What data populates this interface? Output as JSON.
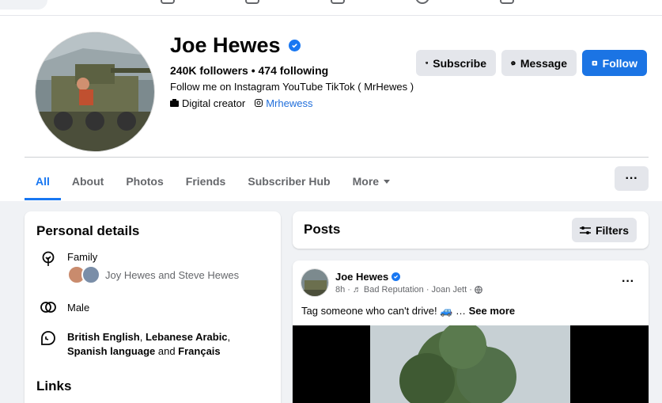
{
  "profile": {
    "name": "Joe Hewes",
    "stats": "240K followers • 474 following",
    "bio": "Follow me on Instagram YouTube TikTok ( MrHewes )",
    "category": "Digital creator",
    "instagram": "Mrhewess"
  },
  "actions": {
    "subscribe": "Subscribe",
    "message": "Message",
    "follow": "Follow"
  },
  "tabs": [
    {
      "label": "All"
    },
    {
      "label": "About"
    },
    {
      "label": "Photos"
    },
    {
      "label": "Friends"
    },
    {
      "label": "Subscriber Hub"
    },
    {
      "label": "More"
    }
  ],
  "more_menu": "···",
  "personal": {
    "title": "Personal details",
    "family_label": "Family",
    "family_names": "Joy Hewes and Steve Hewes",
    "gender": "Male",
    "languages": {
      "lang1": "British English",
      "sep1": ", ",
      "lang2": "Lebanese Arabic",
      "sep2": ", ",
      "lang3": "Spanish language",
      "sep3": " and ",
      "lang4": "Français"
    },
    "links_title": "Links"
  },
  "posts": {
    "title": "Posts",
    "filters": "Filters"
  },
  "post": {
    "author": "Joe Hewes",
    "time": "8h",
    "song": "Bad Reputation · Joan Jett ·",
    "text": "Tag someone who can't drive! 🚙 … ",
    "see_more": "See more",
    "menu": "···"
  },
  "colors": {
    "accent": "#1877f2",
    "link": "#216fdb",
    "page_bg": "#f0f2f5"
  }
}
